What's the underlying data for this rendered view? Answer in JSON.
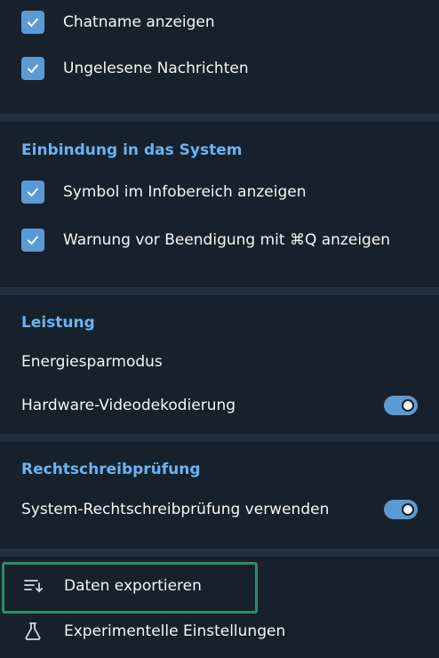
{
  "top": {
    "items": [
      {
        "label": "Chatname anzeigen",
        "checked": true
      },
      {
        "label": "Ungelesene Nachrichten",
        "checked": true
      }
    ]
  },
  "system": {
    "heading": "Einbindung in das System",
    "items": [
      {
        "label": "Symbol im Infobereich anzeigen",
        "checked": true
      },
      {
        "label": "Warnung vor Beendigung mit ⌘Q anzeigen",
        "checked": true
      }
    ]
  },
  "performance": {
    "heading": "Leistung",
    "power_saving": "Energiesparmodus",
    "hw_decoding": {
      "label": "Hardware-Videodekodierung",
      "enabled": true
    }
  },
  "spell": {
    "heading": "Rechtschreibprüfung",
    "system_spell": {
      "label": "System-Rechtschreibprüfung verwenden",
      "enabled": true
    }
  },
  "actions": {
    "export": {
      "label": "Daten exportieren",
      "icon": "export-icon"
    },
    "experimental": {
      "label": "Experimentelle Einstellungen",
      "icon": "flask-icon"
    }
  },
  "colors": {
    "background": "#17212b",
    "separator": "#232e3c",
    "accent": "#5b9bd5",
    "heading": "#6ab3f3",
    "highlight": "#2e8b6a"
  }
}
